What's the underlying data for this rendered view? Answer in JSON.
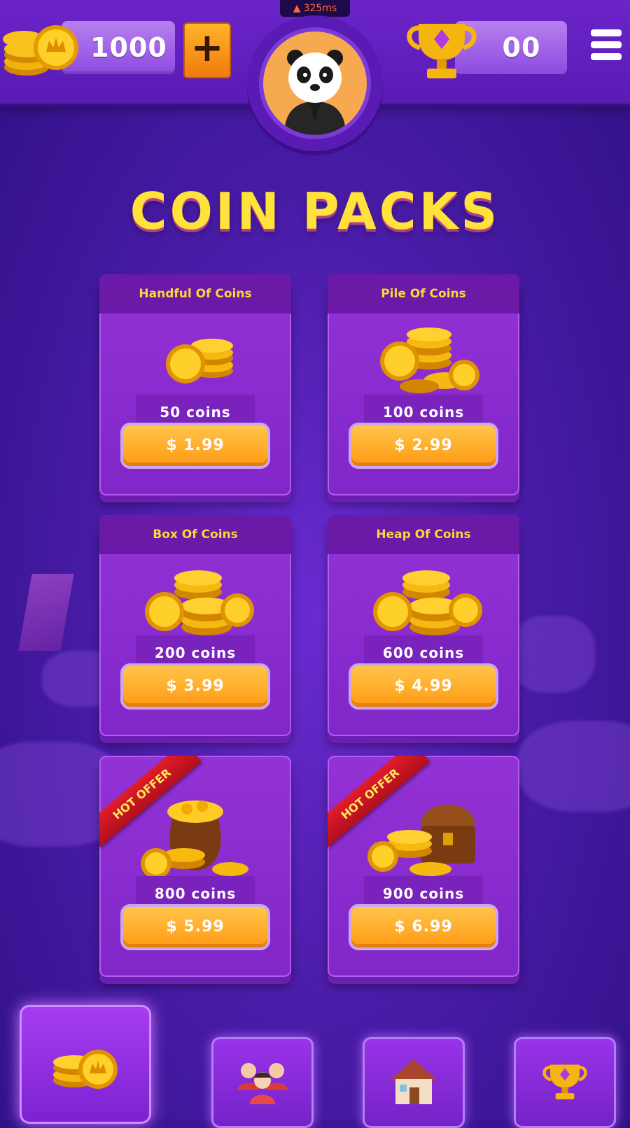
{
  "status": {
    "latency": "325ms"
  },
  "header": {
    "coins": "1000",
    "add_label": "+",
    "trophies": "00"
  },
  "title": "COIN PACKS",
  "packs": [
    {
      "name": "Handful Of Coins",
      "coins": "50 coins",
      "price": "$ 1.99",
      "hot": false
    },
    {
      "name": "Pile Of Coins",
      "coins": "100 coins",
      "price": "$ 2.99",
      "hot": false
    },
    {
      "name": "Box Of Coins",
      "coins": "200 coins",
      "price": "$ 3.99",
      "hot": false
    },
    {
      "name": "Heap Of Coins",
      "coins": "600 coins",
      "price": "$ 4.99",
      "hot": false
    },
    {
      "name": "",
      "coins": "800 coins",
      "price": "$ 5.99",
      "hot": true,
      "badge": "HOT OFFER"
    },
    {
      "name": "",
      "coins": "900 coins",
      "price": "$ 6.99",
      "hot": true,
      "badge": "HOT OFFER"
    }
  ],
  "nav": {
    "items": [
      {
        "icon": "coins-icon",
        "active": true
      },
      {
        "icon": "friends-icon",
        "active": false
      },
      {
        "icon": "home-icon",
        "active": false
      },
      {
        "icon": "trophy-icon",
        "active": false
      }
    ]
  },
  "colors": {
    "accent": "#ffe23a",
    "button": "#ff9a15",
    "card": "#8126c8",
    "hot": "#e21c2a"
  }
}
